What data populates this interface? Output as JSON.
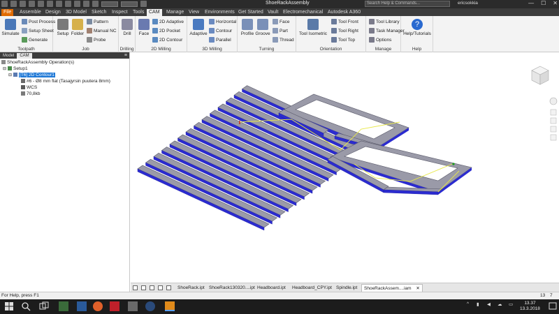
{
  "window": {
    "title": "ShoeRackAssembly",
    "search_placeholder": "Search Help & Commands...",
    "user": "ericsokkia",
    "controls": {
      "minimize": "—",
      "maximize": "☐",
      "close": "✕"
    }
  },
  "menu_tabs": [
    "File",
    "Assemble",
    "Design",
    "3D Model",
    "Sketch",
    "Inspect",
    "Tools",
    "CAM",
    "Manage",
    "View",
    "Environments",
    "Get Started",
    "Vault",
    "Electromechanical",
    "Autodesk A360"
  ],
  "active_tab": "CAM",
  "ribbon": {
    "toolpath": {
      "label": "Toolpath",
      "simulate": "Simulate",
      "post_process": "Post Process",
      "setup_sheet": "Setup Sheet",
      "generate": "Generate"
    },
    "job": {
      "label": "Job",
      "setup": "Setup",
      "folder": "Folder",
      "pattern": "Pattern",
      "manual_nc": "Manual NC",
      "probe": "Probe"
    },
    "drilling": {
      "label": "Drilling",
      "drill": "Drill"
    },
    "milling_2d": {
      "label": "2D Milling",
      "face": "Face",
      "adaptive": "2D Adaptive",
      "pocket": "2D Pocket",
      "contour": "2D Contour"
    },
    "milling_3d": {
      "label": "3D Milling",
      "adaptive": "Adaptive",
      "horizontal": "Horizontal",
      "contour": "Contour",
      "parallel": "Parallel"
    },
    "turning": {
      "label": "Turning",
      "profile": "Profile",
      "groove": "Groove",
      "face": "Face",
      "part": "Part",
      "thread": "Thread"
    },
    "orientation": {
      "label": "Orientation",
      "tool_isometric": "Tool Isometric",
      "tool_front": "Tool Front",
      "tool_right": "Tool Right",
      "tool_top": "Tool Top"
    },
    "manage": {
      "label": "Manage",
      "tool_library": "Tool Library",
      "task_manager": "Task Manager",
      "options": "Options"
    },
    "help": {
      "label": "Help",
      "help_tutorials": "Help/Tutorials"
    }
  },
  "panel": {
    "tabs": [
      "Model",
      "CAM"
    ],
    "active_tab": "CAM",
    "menu_glyph": "≡",
    "tree": [
      {
        "label": "ShoeRackAssembly Operation(s)",
        "level": 0
      },
      {
        "label": "Setup1",
        "level": 1
      },
      {
        "label": "[T6] 2D Contour1",
        "level": 2,
        "selected": true
      },
      {
        "label": "#6 - Ø8 mm flat (Tasajyrsin puutera 8mm)",
        "level": 3
      },
      {
        "label": "WCS",
        "level": 3
      },
      {
        "label": "70,8kb",
        "level": 3
      }
    ]
  },
  "doc_tabs": [
    "ShoeRack.ipt",
    "ShoeRack130320....ipt",
    "Headboard.ipt",
    "Headboard_CPY.ipt",
    "Spindle.ipt",
    "ShoeRackAssem....iam"
  ],
  "active_doc": "ShoeRackAssem....iam",
  "status": {
    "message": "For Help, press F1",
    "count1": "13",
    "count2": "7"
  },
  "taskbar": {
    "time": "13.37",
    "date": "13.3.2018"
  },
  "colors": {
    "file_tab": "#e06a00",
    "selection": "#1e78d6",
    "part_face": "#9a9aa8",
    "part_edge": "#2b2bd0",
    "toolpath": "#e8e84a"
  }
}
